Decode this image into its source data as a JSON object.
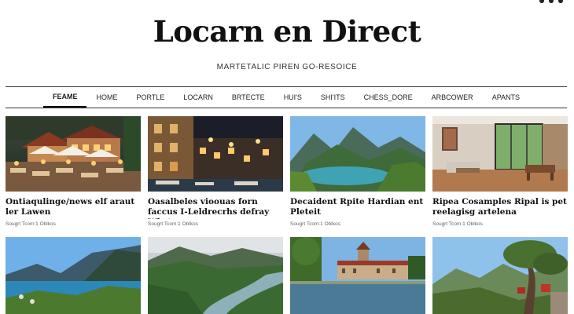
{
  "site": {
    "title": "Locarn en Direct",
    "tagline": "MARTETALIC PIREN GO-RESOICE"
  },
  "nav": {
    "items": [
      "FEAME",
      "HOME",
      "PORTLE",
      "LOCARN",
      "BRTECTE",
      "HUI'S",
      "SHI'ITS",
      "CHESS_DORE",
      "ARBCOWER",
      "APANTS"
    ],
    "active_index": 0
  },
  "articles": [
    {
      "title": "Ontiaqulinge/news elf araut ler Lawen",
      "meta": "Sougrt Tcom:1 Oblkos",
      "image": "outdoor-cafe-night"
    },
    {
      "title": "Oasalbeles vioouas forn faccus I-Leldrecrhs defray Whstees",
      "meta": "Sougrt Tcom:1 Oblkos",
      "image": "harbor-town-night"
    },
    {
      "title": "Decaident Rpite Hardian ent Pleteit",
      "meta": "Sougrt Tcom:1 Oblkos",
      "image": "mountain-lake"
    },
    {
      "title": "Ripea Cosamples Ripal is pet reelagisg artelena",
      "meta": "Sougrt Tcom:1 Oblkos",
      "image": "modern-interior"
    }
  ],
  "row2": [
    {
      "image": "lake-shore-aerial"
    },
    {
      "image": "river-valley"
    },
    {
      "image": "lakeside-castle"
    },
    {
      "image": "mountain-road-tree"
    }
  ]
}
